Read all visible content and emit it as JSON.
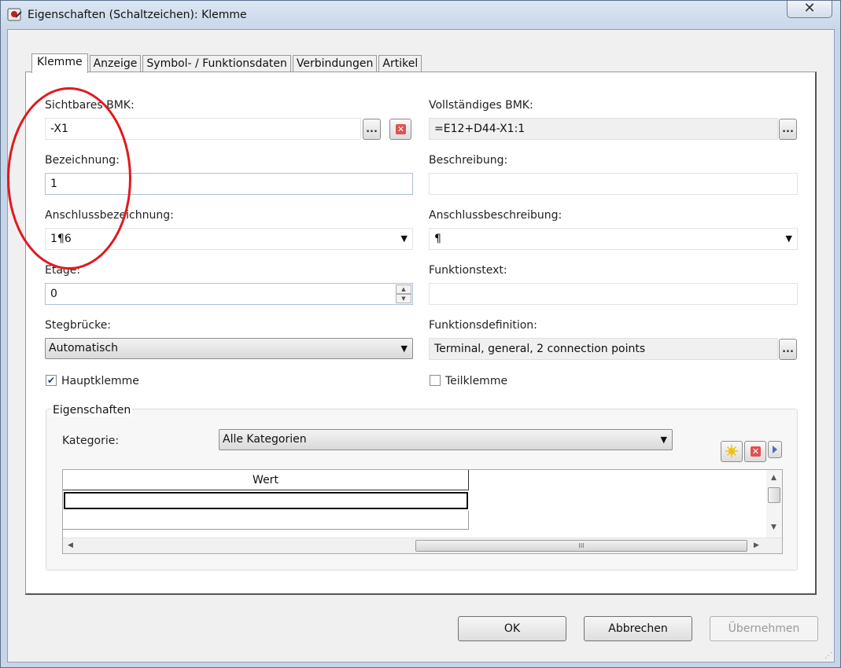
{
  "window": {
    "title": "Eigenschaften (Schaltzeichen): Klemme",
    "close_label": "✕"
  },
  "tabs": [
    {
      "label": "Klemme",
      "active": true
    },
    {
      "label": "Anzeige"
    },
    {
      "label": "Symbol- / Funktionsdaten"
    },
    {
      "label": "Verbindungen"
    },
    {
      "label": "Artikel"
    }
  ],
  "form": {
    "sichtbares_bmk": {
      "label": "Sichtbares BMK:",
      "value": "-X1",
      "browse_label": "..."
    },
    "vollstaendiges_bmk": {
      "label": "Vollständiges BMK:",
      "value": "=E12+D44-X1:1",
      "browse_label": "..."
    },
    "bezeichnung": {
      "label": "Bezeichnung:",
      "value": "1"
    },
    "beschreibung": {
      "label": "Beschreibung:",
      "value": ""
    },
    "anschlussbezeichnung": {
      "label": "Anschlussbezeichnung:",
      "value": "1¶6"
    },
    "anschlussbeschreibung": {
      "label": "Anschlussbeschreibung:",
      "value": "¶"
    },
    "etage": {
      "label": "Etage:",
      "value": "0"
    },
    "funktionstext": {
      "label": "Funktionstext:",
      "value": ""
    },
    "stegbruecke": {
      "label": "Stegbrücke:",
      "value": "Automatisch"
    },
    "funktionsdefinition": {
      "label": "Funktionsdefinition:",
      "value": "Terminal, general, 2 connection points",
      "browse_label": "..."
    },
    "hauptklemme": {
      "label": "Hauptklemme",
      "checked": true
    },
    "teilklemme": {
      "label": "Teilklemme",
      "checked": false
    }
  },
  "eigenschaften": {
    "title": "Eigenschaften",
    "kategorie_label": "Kategorie:",
    "kategorie_value": "Alle Kategorien",
    "grid_header": "Wert",
    "hscroll_grip": "III"
  },
  "buttons": {
    "ok": "OK",
    "abbrechen": "Abbrechen",
    "uebernehmen": "Übernehmen"
  },
  "colors": {
    "annotation_ellipse": "#e0191e",
    "checkmark": "#1d3a8a"
  }
}
